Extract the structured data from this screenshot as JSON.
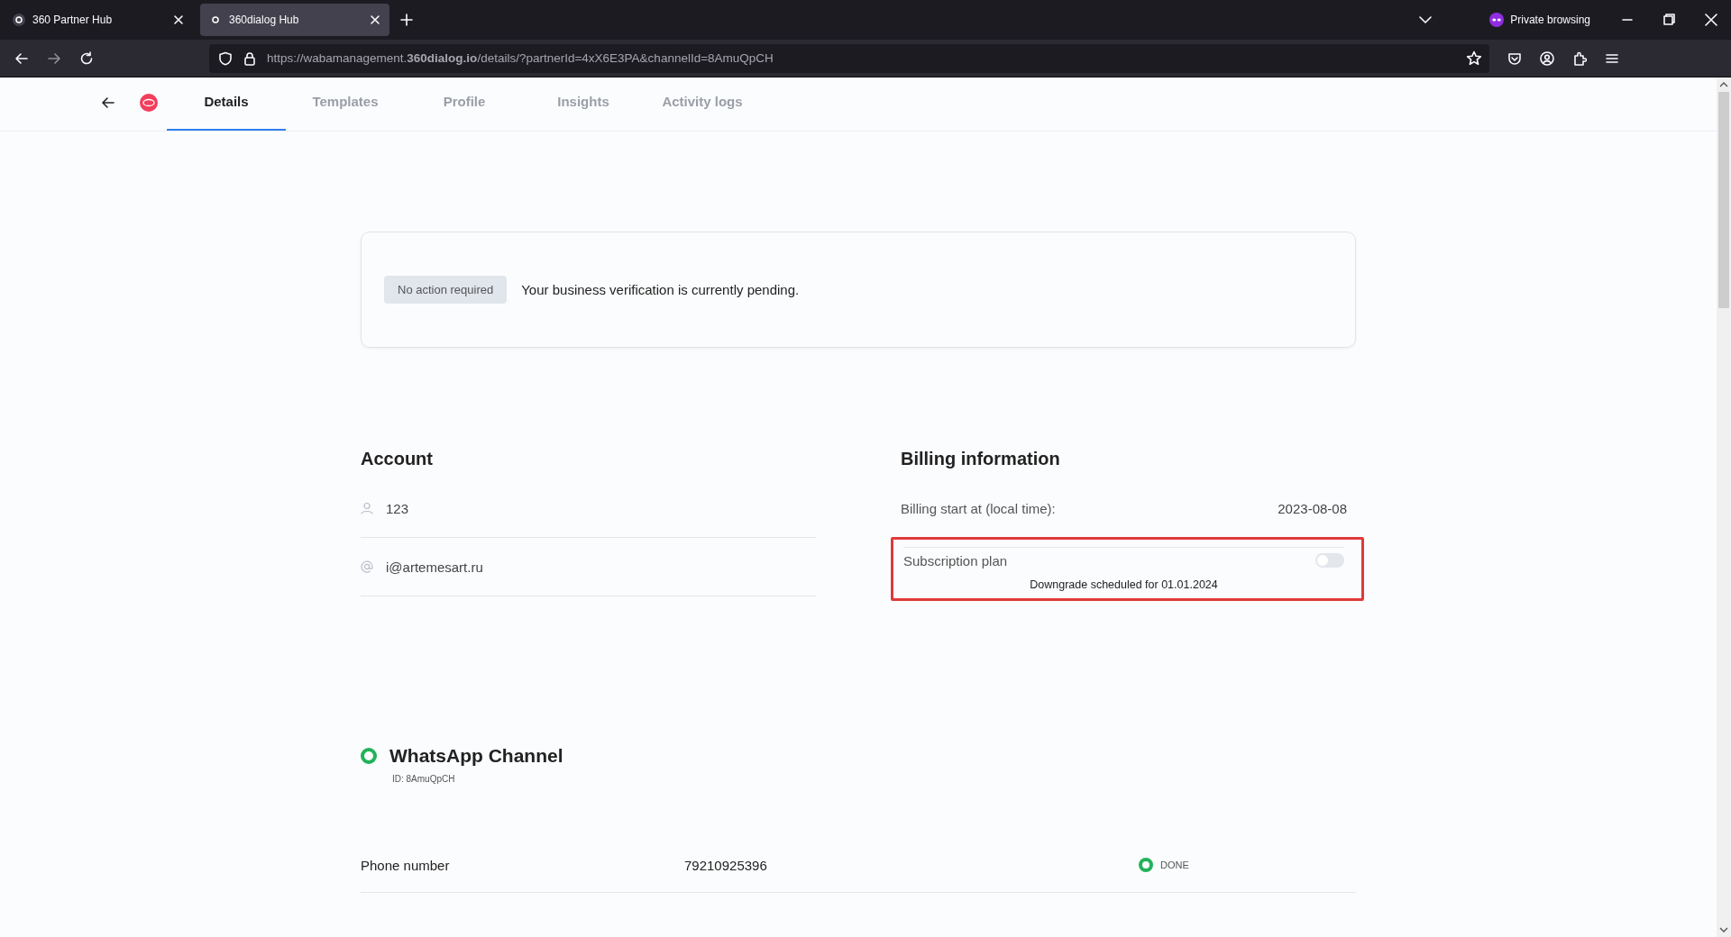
{
  "browser": {
    "tabs": [
      {
        "title": "360 Partner Hub",
        "selected": false
      },
      {
        "title": "360dialog Hub",
        "selected": true
      }
    ],
    "private_label": "Private browsing",
    "url": "https://wabamanagement.**360dialog.io**/details/?partnerId=4xX6E3PA&channelId=8AmuQpCH"
  },
  "page_tabs": [
    {
      "label": "Details",
      "selected": true
    },
    {
      "label": "Templates",
      "selected": false
    },
    {
      "label": "Profile",
      "selected": false
    },
    {
      "label": "Insights",
      "selected": false
    },
    {
      "label": "Activity logs",
      "selected": false
    }
  ],
  "verification": {
    "badge": "No action required",
    "message": "Your business verification is currently pending."
  },
  "account": {
    "title": "Account",
    "rows": [
      {
        "kind": "user",
        "value": "123"
      },
      {
        "kind": "email",
        "value": "i@artemesart.ru"
      }
    ]
  },
  "billing": {
    "title": "Billing information",
    "start_label": "Billing start at (local time):",
    "start_value": "2023-08-08",
    "subscription": {
      "label": "Subscription plan",
      "on": false,
      "highlighted": true,
      "note": "Downgrade scheduled for 01.01.2024"
    }
  },
  "channel": {
    "title": "WhatsApp Channel",
    "id": "ID: 8AmuQpCH",
    "rows": [
      {
        "label": "Phone number",
        "value": "79210925396",
        "status": "DONE"
      }
    ]
  }
}
